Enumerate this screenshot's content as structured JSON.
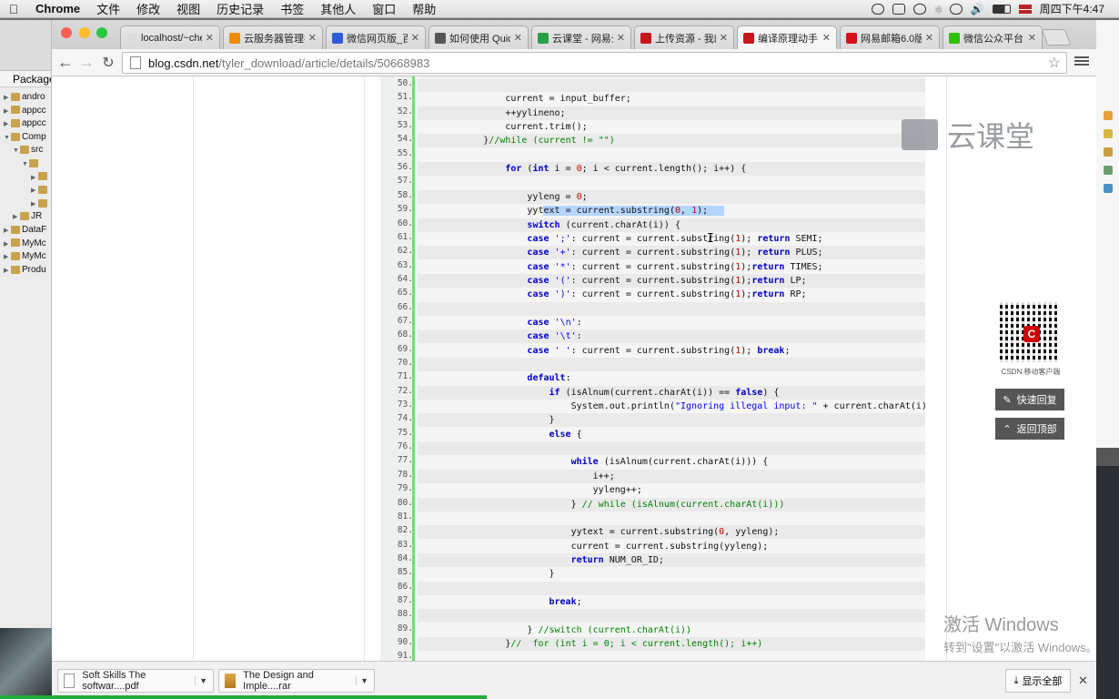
{
  "menubar": {
    "app": "Chrome",
    "items": [
      "文件",
      "修改",
      "视图",
      "历史记录",
      "书签",
      "其他人",
      "窗口",
      "帮助"
    ],
    "clock": "周四下午4:47"
  },
  "tabs": [
    {
      "label": "localhost/~che",
      "fav_color": "#dddddd",
      "active": false
    },
    {
      "label": "云服务器管理控",
      "fav_color": "#f08b00",
      "active": false
    },
    {
      "label": "微信网页版_百度",
      "fav_color": "#2e5bd8",
      "active": false
    },
    {
      "label": "如何使用 Quick",
      "fav_color": "#555555",
      "active": false
    },
    {
      "label": "云课堂 - 网易云",
      "fav_color": "#2aa148",
      "active": false
    },
    {
      "label": "上传资源 - 我的",
      "fav_color": "#c8161d",
      "active": false
    },
    {
      "label": "编译原理动手实",
      "fav_color": "#c8161d",
      "active": true
    },
    {
      "label": "网易邮箱6.0版",
      "fav_color": "#d6101a",
      "active": false
    },
    {
      "label": "微信公众平台",
      "fav_color": "#2ec100",
      "active": false
    }
  ],
  "omnibox": {
    "host": "blog.csdn.net",
    "path": "/tyler_download/article/details/50668983"
  },
  "eclipse": {
    "title": "Package",
    "tree": [
      {
        "label": "andro",
        "indent": 0,
        "twisty": "▶"
      },
      {
        "label": "appcc",
        "indent": 0,
        "twisty": "▶"
      },
      {
        "label": "appcc",
        "indent": 0,
        "twisty": "▶"
      },
      {
        "label": "Comp",
        "indent": 0,
        "twisty": "▼"
      },
      {
        "label": "src",
        "indent": 1,
        "twisty": "▼"
      },
      {
        "label": "",
        "indent": 2,
        "twisty": "▼"
      },
      {
        "label": "",
        "indent": 3,
        "twisty": "▶"
      },
      {
        "label": "",
        "indent": 3,
        "twisty": "▶"
      },
      {
        "label": "",
        "indent": 3,
        "twisty": "▶"
      },
      {
        "label": "JR",
        "indent": 1,
        "twisty": "▶"
      },
      {
        "label": "DataF",
        "indent": 0,
        "twisty": "▶"
      },
      {
        "label": "MyMc",
        "indent": 0,
        "twisty": "▶"
      },
      {
        "label": "MyMc",
        "indent": 0,
        "twisty": "▶"
      },
      {
        "label": "Produ",
        "indent": 0,
        "twisty": "▶"
      }
    ]
  },
  "code": {
    "lines": [
      {
        "n": "50.",
        "t": ""
      },
      {
        "n": "51.",
        "t": "                current = input_buffer;"
      },
      {
        "n": "52.",
        "t": "                ++yylineno;"
      },
      {
        "n": "53.",
        "t": "                current.trim();"
      },
      {
        "n": "54.",
        "t": "            }//while (current != \"\")"
      },
      {
        "n": "55.",
        "t": ""
      },
      {
        "n": "56.",
        "t": "                for (int i = 0; i < current.length(); i++) {"
      },
      {
        "n": "57.",
        "t": ""
      },
      {
        "n": "58.",
        "t": "                    yyleng = 0;"
      },
      {
        "n": "59.",
        "t": "                    yytext = current.substring(0, 1);"
      },
      {
        "n": "60.",
        "t": "                    switch (current.charAt(i)) {"
      },
      {
        "n": "61.",
        "t": "                    case ';': current = current.substring(1); return SEMI;"
      },
      {
        "n": "62.",
        "t": "                    case '+': current = current.substring(1); return PLUS;"
      },
      {
        "n": "63.",
        "t": "                    case '*': current = current.substring(1);return TIMES;"
      },
      {
        "n": "64.",
        "t": "                    case '(': current = current.substring(1);return LP;"
      },
      {
        "n": "65.",
        "t": "                    case ')': current = current.substring(1);return RP;"
      },
      {
        "n": "66.",
        "t": ""
      },
      {
        "n": "67.",
        "t": "                    case '\\n':"
      },
      {
        "n": "68.",
        "t": "                    case '\\t':"
      },
      {
        "n": "69.",
        "t": "                    case ' ': current = current.substring(1); break;"
      },
      {
        "n": "70.",
        "t": ""
      },
      {
        "n": "71.",
        "t": "                    default:"
      },
      {
        "n": "72.",
        "t": "                        if (isAlnum(current.charAt(i)) == false) {"
      },
      {
        "n": "73.",
        "t": "                            System.out.println(\"Ignoring illegal input: \" + current.charAt(i));"
      },
      {
        "n": "74.",
        "t": "                        }"
      },
      {
        "n": "75.",
        "t": "                        else {"
      },
      {
        "n": "76.",
        "t": ""
      },
      {
        "n": "77.",
        "t": "                            while (isAlnum(current.charAt(i))) {"
      },
      {
        "n": "78.",
        "t": "                                i++;"
      },
      {
        "n": "79.",
        "t": "                                yyleng++;"
      },
      {
        "n": "80.",
        "t": "                            } // while (isAlnum(current.charAt(i)))"
      },
      {
        "n": "81.",
        "t": ""
      },
      {
        "n": "82.",
        "t": "                            yytext = current.substring(0, yyleng);"
      },
      {
        "n": "83.",
        "t": "                            current = current.substring(yyleng);"
      },
      {
        "n": "84.",
        "t": "                            return NUM_OR_ID;"
      },
      {
        "n": "85.",
        "t": "                        }"
      },
      {
        "n": "86.",
        "t": ""
      },
      {
        "n": "87.",
        "t": "                        break;"
      },
      {
        "n": "88.",
        "t": ""
      },
      {
        "n": "89.",
        "t": "                    } //switch (current.charAt(i))"
      },
      {
        "n": "90.",
        "t": "                }//  for (int i = 0; i < current.length(); i++)"
      },
      {
        "n": "91.",
        "t": ""
      }
    ]
  },
  "watermark": {
    "text": "云课堂"
  },
  "sidebar": {
    "qr_caption": "CSDN 移动客户端",
    "qr_letter": "C",
    "quick_reply": "快速回复",
    "back_to_top": "返回顶部"
  },
  "activate": {
    "line1": "激活 Windows",
    "line2": "转到\"设置\"以激活 Windows。"
  },
  "downloads": {
    "items": [
      {
        "label": "Soft Skills The softwar....pdf"
      },
      {
        "label": "The Design and Imple....rar"
      }
    ],
    "show_all": "显示全部"
  }
}
